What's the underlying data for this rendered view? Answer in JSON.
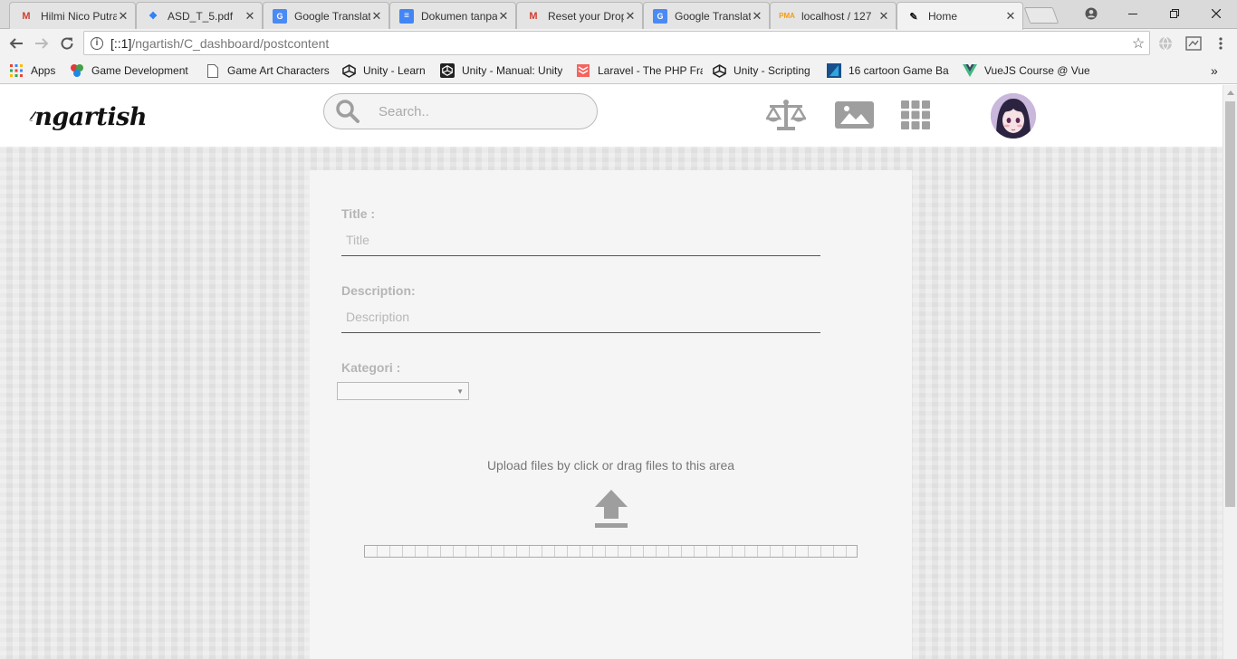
{
  "browser": {
    "tabs": [
      {
        "title": "Hilmi Nico Putra",
        "favicon": "gmail-icon"
      },
      {
        "title": "ASD_T_5.pdf",
        "favicon": "dropbox-icon"
      },
      {
        "title": "Google Translate",
        "favicon": "google-translate-icon"
      },
      {
        "title": "Dokumen tanpa",
        "favicon": "google-docs-icon"
      },
      {
        "title": "Reset your Dropbox",
        "favicon": "gmail-icon"
      },
      {
        "title": "Google Translate",
        "favicon": "google-translate-icon"
      },
      {
        "title": "localhost / 127",
        "favicon": "phpmyadmin-icon"
      },
      {
        "title": "Home",
        "favicon": "brush-icon",
        "active": true
      }
    ],
    "url_prefix": "[::1]",
    "url_path": "/ngartish/C_dashboard/postcontent",
    "bookmarks": [
      {
        "label": "Apps",
        "icon": "apps-grid-icon"
      },
      {
        "label": "Game Development",
        "icon": "colored-dots-icon"
      },
      {
        "label": "Game Art Characters",
        "icon": "page-icon"
      },
      {
        "label": "Unity - Learn",
        "icon": "unity-icon"
      },
      {
        "label": "Unity - Manual: Unity",
        "icon": "unity-icon"
      },
      {
        "label": "Laravel - The PHP Fra",
        "icon": "laravel-icon"
      },
      {
        "label": "Unity - Scripting",
        "icon": "unity-icon"
      },
      {
        "label": "16 cartoon Game Ba",
        "icon": "photoshop-icon"
      },
      {
        "label": "VueJS Course @ Vue",
        "icon": "vue-icon"
      }
    ],
    "bookmarks_overflow": "»"
  },
  "site": {
    "logo_text": "ngartish",
    "search_placeholder": "Search.."
  },
  "form": {
    "title_label": "Title :",
    "title_placeholder": "Title",
    "description_label": "Description:",
    "description_placeholder": "Description",
    "category_label": "Kategori :",
    "category_value": "",
    "upload_text": "Upload files by click or drag files to this area"
  },
  "colors": {
    "icon_gray": "#9e9e9e",
    "label_gray": "#b5b5b5"
  }
}
